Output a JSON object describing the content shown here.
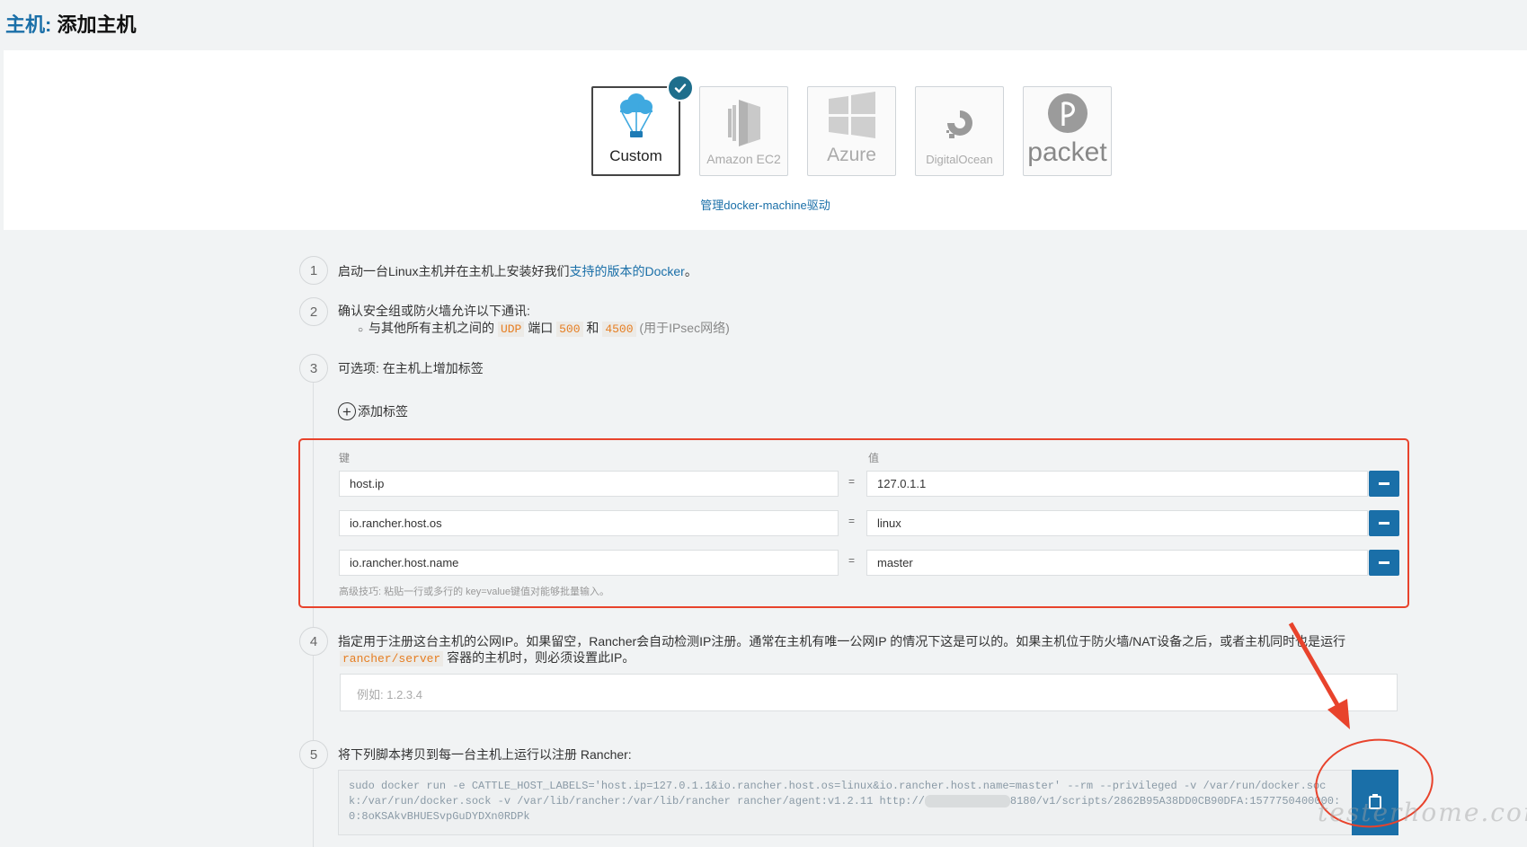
{
  "header": {
    "prefix": "主机:",
    "title": "添加主机"
  },
  "drivers": [
    {
      "name": "Custom",
      "selected": true,
      "icon": "parachute-icon"
    },
    {
      "name": "Amazon EC2",
      "selected": false,
      "icon": "amazon-ec2-icon"
    },
    {
      "name": "Azure",
      "selected": false,
      "icon": "windows-icon"
    },
    {
      "name": "DigitalOcean",
      "selected": false,
      "icon": "digitalocean-icon"
    },
    {
      "name": "packet",
      "selected": false,
      "icon": "packet-icon"
    }
  ],
  "manage_link": "管理docker-machine驱动",
  "steps": {
    "s1": {
      "num": "1",
      "pre": "启动一台Linux主机并在主机上安装好我们",
      "link": "支持的版本的Docker",
      "post": "。"
    },
    "s2": {
      "num": "2",
      "title": "确认安全组或防火墙允许以下通讯:",
      "bullet_pre": "与其他所有主机之间的",
      "udp": "UDP",
      "port_word": "端口",
      "port1": "500",
      "and": "和",
      "port2": "4500",
      "note": "(用于IPsec网络)"
    },
    "s3": {
      "num": "3",
      "title": "可选项: 在主机上增加标签"
    },
    "s4": {
      "num": "4",
      "line1": "指定用于注册这台主机的公网IP。如果留空，Rancher会自动检测IP注册。通常在主机有唯一公网IP 的情况下这是可以的。如果主机位于防火墙/NAT设备之后，或者主机同时也是运行",
      "code": "rancher/server",
      "line2": "容器的主机时，则必须设置此IP。",
      "placeholder": "例如: 1.2.3.4"
    },
    "s5": {
      "num": "5",
      "title": "将下列脚本拷贝到每一台主机上运行以注册 Rancher:"
    }
  },
  "labels": {
    "add_label": "添加标签",
    "key_header": "键",
    "value_header": "值",
    "eq": "=",
    "rows": [
      {
        "key": "host.ip",
        "value": "127.0.1.1"
      },
      {
        "key": "io.rancher.host.os",
        "value": "linux"
      },
      {
        "key": "io.rancher.host.name",
        "value": "master"
      }
    ],
    "hint": "高级技巧: 粘贴一行或多行的 key=value键值对能够批量输入。"
  },
  "script": {
    "line1": "sudo docker run -e CATTLE_HOST_LABELS='host.ip=127.0.1.1&io.rancher.host.os=linux&io.rancher.host.name=master'  --rm --privileged -v /var/run/docker.soc",
    "line2a": "k:/var/run/docker.sock -v /var/lib/rancher:/var/lib/rancher rancher/agent:v1.2.11 http://",
    "line2b": "8180/v1/scripts/2862B95A38DD0CB90DFA:1577750400000:",
    "line3": "0:8oKSAkvBHUESvpGuDYDXn0RDPk"
  },
  "watermark": "testerhome.com",
  "colors": {
    "accent": "#1a6fa8",
    "highlight": "#e8432c",
    "badge": "#1e6e8c",
    "code": "#e67e22"
  }
}
